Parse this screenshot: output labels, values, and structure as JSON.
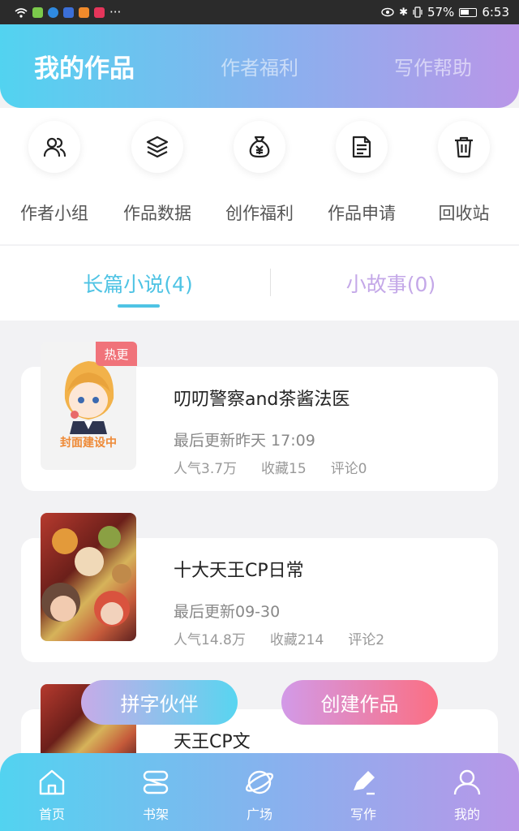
{
  "statusbar": {
    "battery": "57%",
    "time": "6:53"
  },
  "header": {
    "tabs": [
      {
        "label": "我的作品"
      },
      {
        "label": "作者福利"
      },
      {
        "label": "写作帮助"
      }
    ]
  },
  "actions": [
    {
      "label": "作者小组",
      "icon": "group-icon"
    },
    {
      "label": "作品数据",
      "icon": "layers-icon"
    },
    {
      "label": "创作福利",
      "icon": "money-bag-icon"
    },
    {
      "label": "作品申请",
      "icon": "document-icon"
    },
    {
      "label": "回收站",
      "icon": "trash-icon"
    }
  ],
  "subtabs": [
    {
      "label": "长篇小说(4)"
    },
    {
      "label": "小故事(0)"
    }
  ],
  "works": [
    {
      "badge": "热更",
      "cover_text": "封面建设中",
      "title": "叨叨警察and茶酱法医",
      "updated": "最后更新昨天 17:09",
      "popularity": "人气3.7万",
      "favorites": "收藏15",
      "comments": "评论0"
    },
    {
      "title": "十大天王CP日常",
      "updated": "最后更新09-30",
      "popularity": "人气14.8万",
      "favorites": "收藏214",
      "comments": "评论2"
    },
    {
      "title": "天王CP文"
    }
  ],
  "buttons": {
    "partner": "拼字伙伴",
    "create": "创建作品"
  },
  "bottomnav": [
    {
      "label": "首页",
      "icon": "home-icon"
    },
    {
      "label": "书架",
      "icon": "bookshelf-icon"
    },
    {
      "label": "广场",
      "icon": "planet-icon"
    },
    {
      "label": "写作",
      "icon": "pen-icon"
    },
    {
      "label": "我的",
      "icon": "user-icon"
    }
  ],
  "colors": {
    "accent_cyan": "#4ec3e4",
    "accent_purple": "#c4a8e8",
    "badge_red": "#f0737a"
  }
}
